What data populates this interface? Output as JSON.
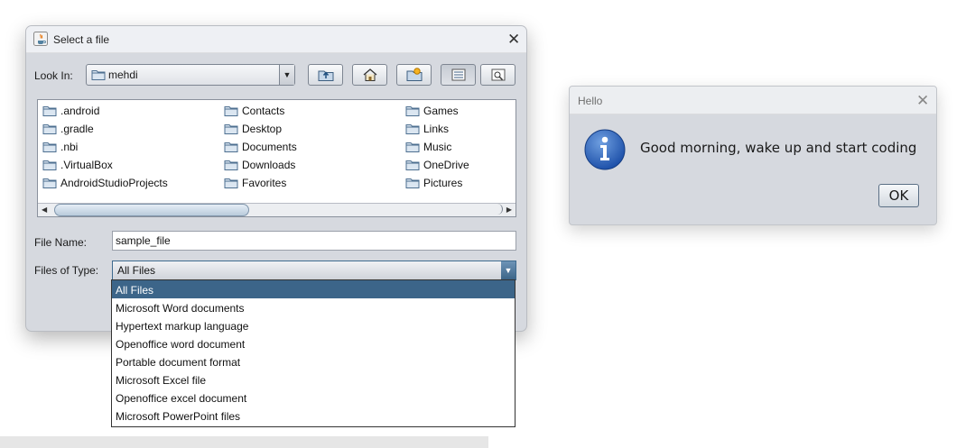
{
  "file_chooser": {
    "title": "Select a file",
    "look_in_label": "Look In:",
    "look_in_value": "mehdi",
    "toolbar": {
      "up_folder_icon": "up-one-level-icon",
      "home_icon": "home-icon",
      "new_folder_icon": "new-folder-icon",
      "list_view_icon": "list-view-icon",
      "details_view_icon": "details-view-icon"
    },
    "files": [
      [
        ".android",
        ".gradle",
        ".nbi",
        ".VirtualBox",
        "AndroidStudioProjects"
      ],
      [
        "Contacts",
        "Desktop",
        "Documents",
        "Downloads",
        "Favorites"
      ],
      [
        "Games",
        "Links",
        "Music",
        "OneDrive",
        "Pictures"
      ]
    ],
    "file_name_label": "File Name:",
    "file_name_value": "sample_file",
    "files_of_type_label": "Files of Type:",
    "files_of_type_value": "All Files",
    "type_options": [
      "All Files",
      "Microsoft Word documents",
      "Hypertext markup language",
      "Openoffice word document",
      "Portable document format",
      "Microsoft Excel file",
      "Openoffice excel document",
      "Microsoft PowerPoint files"
    ],
    "selected_type_index": 0
  },
  "message_dialog": {
    "title": "Hello",
    "message": "Good morning, wake up and start coding",
    "ok_label": "OK",
    "icon": "information-icon"
  },
  "colors": {
    "selection": "#3c6589",
    "dialog_bg": "#d6d9df"
  }
}
